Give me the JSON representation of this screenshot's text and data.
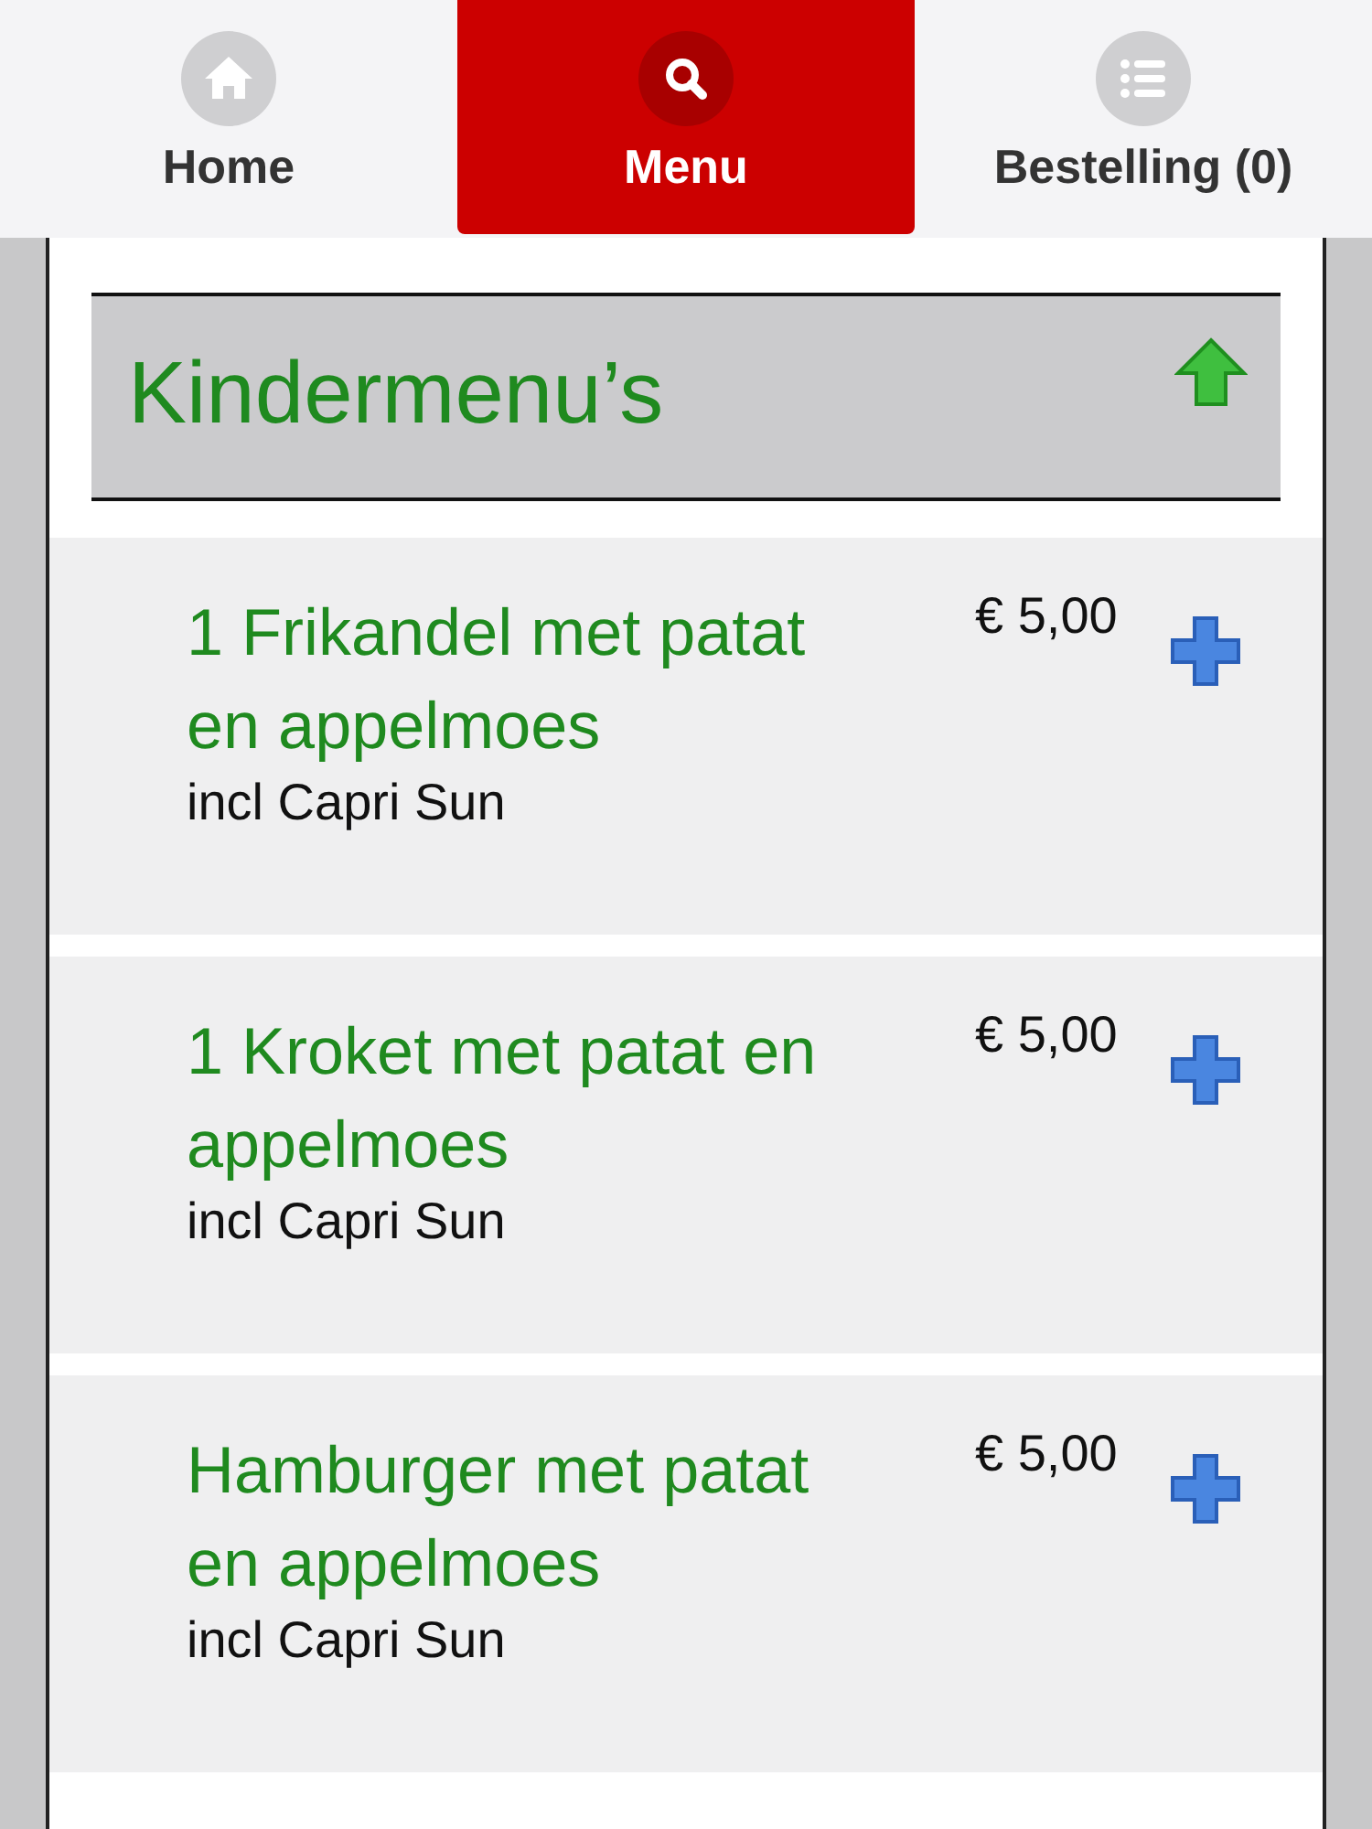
{
  "tabs": [
    {
      "label": "Home",
      "kind": "home",
      "selected": false
    },
    {
      "label": "Menu",
      "kind": "search",
      "selected": true
    },
    {
      "label": "Bestelling (0)",
      "kind": "list",
      "selected": false
    }
  ],
  "section": {
    "title": "Kindermenu’s"
  },
  "items": [
    {
      "name": "1 Frikandel met patat en appelmoes",
      "description": "incl Capri Sun",
      "price": "€ 5,00"
    },
    {
      "name": "1 Kroket met patat en appelmoes",
      "description": "incl Capri Sun",
      "price": "€ 5,00"
    },
    {
      "name": "Hamburger met patat en appelmoes",
      "description": "incl Capri Sun",
      "price": "€ 5,00"
    }
  ]
}
